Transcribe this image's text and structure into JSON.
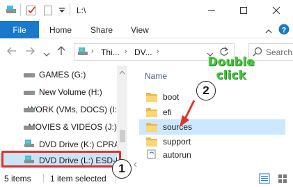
{
  "window": {
    "title": "L:\\",
    "quick_access": [
      "checkmark-icon",
      "blank-page-icon",
      "dropdown-arrow-icon"
    ],
    "controls": [
      "minimize-icon",
      "maximize-icon",
      "close-icon"
    ]
  },
  "ribbon": {
    "tabs": [
      "File",
      "Home",
      "Share",
      "View"
    ],
    "controls": [
      "collapse-chevron-icon",
      "help-icon"
    ]
  },
  "address": {
    "crumbs": [
      "Thi...",
      "DV..."
    ],
    "search_placeholder": "Search"
  },
  "nav": {
    "items": [
      {
        "label": "GAMES (G:)",
        "icon": "drive-icon"
      },
      {
        "label": "New Volume (H:)",
        "icon": "drive-icon"
      },
      {
        "label": "WORK (VMs, DOCS) (I:)",
        "icon": "drive-icon"
      },
      {
        "label": "MOVIES & VIDEOS (J:)",
        "icon": "drive-icon"
      },
      {
        "label": "DVD Drive (K:) CPRA_X",
        "icon": "dvd-drive-icon"
      },
      {
        "label": "DVD Drive (L:) ESD-IS",
        "icon": "dvd-drive-icon",
        "selected": true
      }
    ]
  },
  "content": {
    "column_header": "Name",
    "files": [
      {
        "name": "boot",
        "icon": "folder-icon"
      },
      {
        "name": "efi",
        "icon": "folder-icon"
      },
      {
        "name": "sources",
        "icon": "folder-icon",
        "selected": true
      },
      {
        "name": "support",
        "icon": "folder-icon"
      },
      {
        "name": "autorun",
        "icon": "autorun-file-icon"
      }
    ]
  },
  "status": {
    "items_count": "5 items",
    "selection": "1 item selected"
  },
  "annotations": {
    "step1": "1",
    "step2": "2",
    "note_line1": "Double",
    "note_line2": "click",
    "color": "#e0342b",
    "note_color": "#3fcb3a"
  },
  "colors": {
    "file_tab": "#1979ca",
    "selection": "#cce8ff",
    "nav_selection": "#cce4f7"
  }
}
